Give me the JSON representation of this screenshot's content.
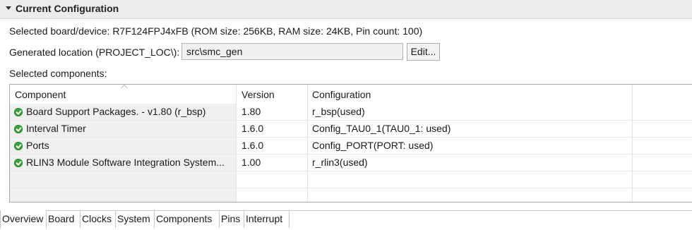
{
  "section": {
    "title": "Current Configuration"
  },
  "device_line": "Selected board/device: R7F124FPJ4xFB (ROM size: 256KB, RAM size: 24KB, Pin count: 100)",
  "location": {
    "label": "Generated location (PROJECT_LOC\\):",
    "value": "src\\smc_gen",
    "edit_label": "Edit..."
  },
  "components_label": "Selected components:",
  "table": {
    "columns": [
      "Component",
      "Version",
      "Configuration"
    ],
    "rows": [
      {
        "component": "Board Support Packages. - v1.80 (r_bsp)",
        "version": "1.80",
        "configuration": "r_bsp(used)",
        "status_icon": "ok-icon"
      },
      {
        "component": "Interval Timer",
        "version": "1.6.0",
        "configuration": "Config_TAU0_1(TAU0_1: used)",
        "status_icon": "ok-icon"
      },
      {
        "component": "Ports",
        "version": "1.6.0",
        "configuration": "Config_PORT(PORT: used)",
        "status_icon": "ok-icon"
      },
      {
        "component": "RLIN3 Module Software Integration System...",
        "version": "1.00",
        "configuration": "r_rlin3(used)",
        "status_icon": "ok-icon"
      }
    ]
  },
  "tabs": [
    "Overview",
    "Board",
    "Clocks",
    "System",
    "Components",
    "Pins",
    "Interrupt"
  ],
  "active_tab": "Overview",
  "colors": {
    "ok_icon": "#3aa335",
    "header_bg": "#ececec"
  }
}
